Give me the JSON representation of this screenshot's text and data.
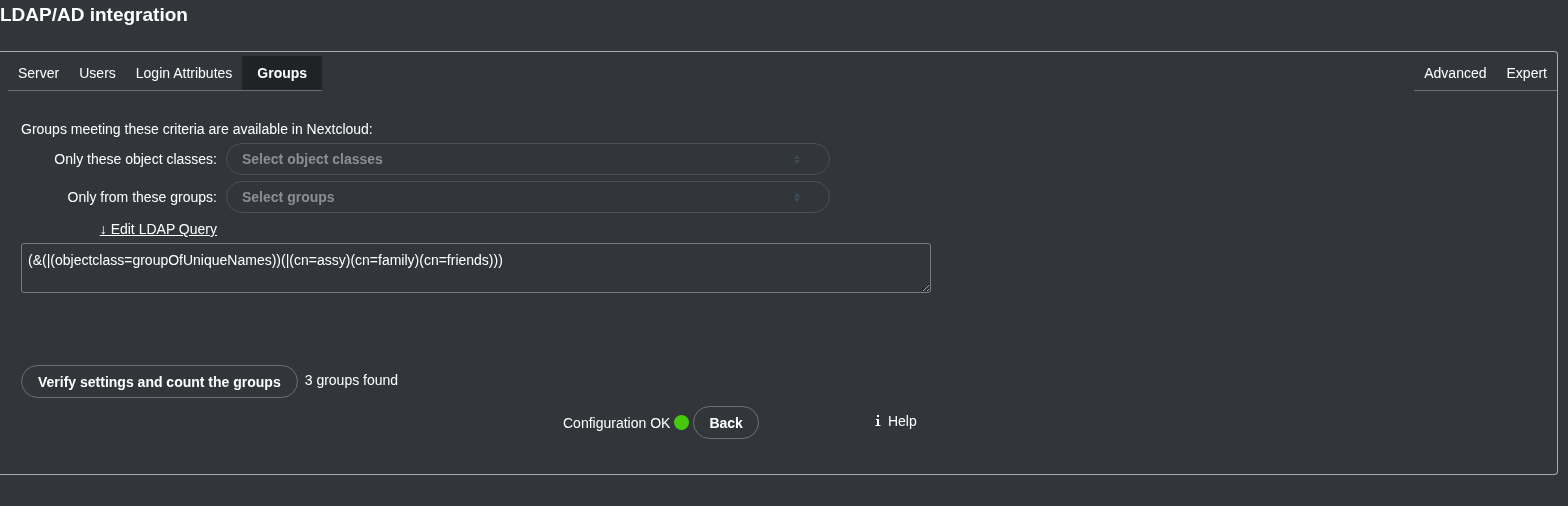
{
  "title": "LDAP/AD integration",
  "tabs": [
    {
      "label": "Server",
      "selected": false
    },
    {
      "label": "Users",
      "selected": false
    },
    {
      "label": "Login Attributes",
      "selected": false
    },
    {
      "label": "Groups",
      "selected": true
    }
  ],
  "right_tabs": [
    {
      "label": "Advanced",
      "selected": false
    },
    {
      "label": "Expert",
      "selected": false
    }
  ],
  "intro": "Groups meeting these criteria are available in Nextcloud:",
  "filters": [
    {
      "label": "Only these object classes:",
      "placeholder": "Select object classes"
    },
    {
      "label": "Only from these groups:",
      "placeholder": "Select groups"
    }
  ],
  "edit_query_link": "↓ Edit LDAP Query",
  "query": "(&(|(objectclass=groupOfUniqueNames))(|(cn=assy)(cn=family)(cn=friends)))",
  "verify_button": "Verify settings and count the groups",
  "result": "3 groups found",
  "status": {
    "text": "Configuration OK",
    "ok": true
  },
  "back_button": "Back",
  "help": "Help"
}
